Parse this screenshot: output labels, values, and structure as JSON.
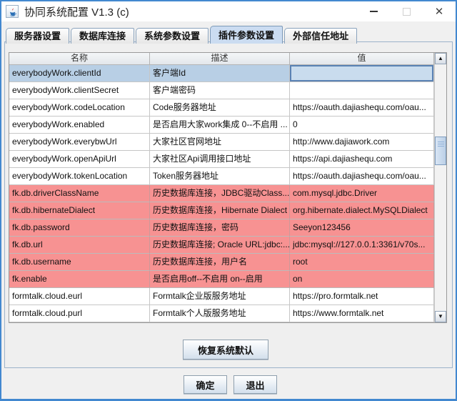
{
  "window": {
    "title": "协同系统配置 V1.3 (c)"
  },
  "icons": {
    "app": "java-cup-icon",
    "minimize": "—",
    "maximize": "□",
    "close": "✕",
    "scroll_up": "▲",
    "scroll_down": "▼"
  },
  "colors": {
    "window_border": "#4288d0",
    "selection_blue": "#b8cfe5",
    "highlight_pink": "#f79292",
    "tab_selected": "#cbdcf1"
  },
  "tabs": [
    {
      "label": "服务器设置",
      "selected": false
    },
    {
      "label": "数据库连接",
      "selected": false
    },
    {
      "label": "系统参数设置",
      "selected": false
    },
    {
      "label": "插件参数设置",
      "selected": true
    },
    {
      "label": "外部信任地址",
      "selected": false
    }
  ],
  "table": {
    "columns": [
      "名称",
      "描述",
      "值"
    ],
    "rows": [
      {
        "name": "everybodyWork.clientId",
        "desc": "客户端Id",
        "value": "",
        "state": "selected"
      },
      {
        "name": "everybodyWork.clientSecret",
        "desc": "客户端密码",
        "value": "",
        "state": "normal"
      },
      {
        "name": "everybodyWork.codeLocation",
        "desc": "Code服务器地址",
        "value": "https://oauth.dajiashequ.com/oau...",
        "state": "normal"
      },
      {
        "name": "everybodyWork.enabled",
        "desc": "是否启用大家work集成 0--不启用  ...",
        "value": "0",
        "state": "normal"
      },
      {
        "name": "everybodyWork.everybwUrl",
        "desc": "大家社区官网地址",
        "value": "http://www.dajiawork.com",
        "state": "normal"
      },
      {
        "name": "everybodyWork.openApiUrl",
        "desc": "大家社区Api调用接口地址",
        "value": "https://api.dajiashequ.com",
        "state": "normal"
      },
      {
        "name": "everybodyWork.tokenLocation",
        "desc": "Token服务器地址",
        "value": "https://oauth.dajiashequ.com/oau...",
        "state": "normal"
      },
      {
        "name": "fk.db.driverClassName",
        "desc": "历史数据库连接，JDBC驱动Class...",
        "value": "com.mysql.jdbc.Driver",
        "state": "highlight"
      },
      {
        "name": "fk.db.hibernateDialect",
        "desc": "历史数据库连接，Hibernate Dialect",
        "value": "org.hibernate.dialect.MySQLDialect",
        "state": "highlight"
      },
      {
        "name": "fk.db.password",
        "desc": "历史数据库连接，密码",
        "value": "Seeyon123456",
        "state": "highlight"
      },
      {
        "name": "fk.db.url",
        "desc": "历史数据库连接; Oracle URL:jdbc:...",
        "value": "jdbc:mysql://127.0.0.1:3361/v70s...",
        "state": "highlight"
      },
      {
        "name": "fk.db.username",
        "desc": "历史数据库连接，用户名",
        "value": "root",
        "state": "highlight"
      },
      {
        "name": "fk.enable",
        "desc": "是否启用off--不启用  on--启用",
        "value": "on",
        "state": "highlight"
      },
      {
        "name": "formtalk.cloud.eurl",
        "desc": "Formtalk企业版服务地址",
        "value": "https://pro.formtalk.net",
        "state": "normal"
      },
      {
        "name": "formtalk.cloud.purl",
        "desc": "Formtalk个人版服务地址",
        "value": "https://www.formtalk.net",
        "state": "normal"
      }
    ]
  },
  "buttons": {
    "restore_defaults": "恢复系统默认",
    "ok": "确定",
    "exit": "退出"
  }
}
